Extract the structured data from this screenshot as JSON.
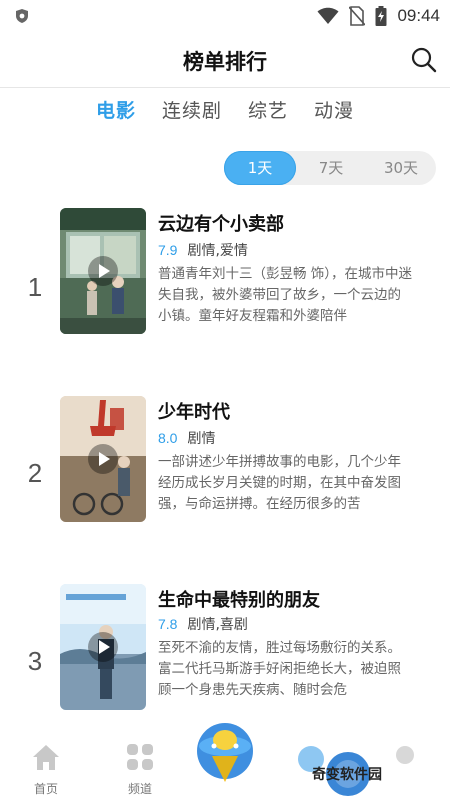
{
  "status_bar": {
    "time": "09:44"
  },
  "header": {
    "title": "榜单排行"
  },
  "tabs": [
    {
      "label": "电影",
      "active": true
    },
    {
      "label": "连续剧",
      "active": false
    },
    {
      "label": "综艺",
      "active": false
    },
    {
      "label": "动漫",
      "active": false
    }
  ],
  "period": {
    "options": [
      "1天",
      "7天",
      "30天"
    ],
    "selected": "1天"
  },
  "items": [
    {
      "rank": "1",
      "title": "云边有个小卖部",
      "score": "7.9",
      "genre": "剧情,爱情",
      "desc": "普通青年刘十三（彭昱畅 饰），在城市中迷失自我，被外婆带回了故乡，一个云边的小镇。童年好友程霜和外婆陪伴"
    },
    {
      "rank": "2",
      "title": "少年时代",
      "score": "8.0",
      "genre": "剧情",
      "desc": "一部讲述少年拼搏故事的电影，几个少年经历成长岁月关键的时期，在其中奋发图强，与命运拼搏。在经历很多的苦"
    },
    {
      "rank": "3",
      "title": "生命中最特别的朋友",
      "score": "7.8",
      "genre": "剧情,喜剧",
      "desc": "至死不渝的友情，胜过每场敷衍的关系。富二代托马斯游手好闲拒绝长大，被迫照顾一个身患先天疾病、随时会危"
    }
  ],
  "bottom_nav": [
    {
      "label": "首页",
      "icon": "home-icon"
    },
    {
      "label": "频道",
      "icon": "grid-icon"
    }
  ],
  "watermark": "奇变软件园",
  "colors": {
    "accent": "#2f9ee8",
    "segment_active": "#4ab0f2"
  }
}
